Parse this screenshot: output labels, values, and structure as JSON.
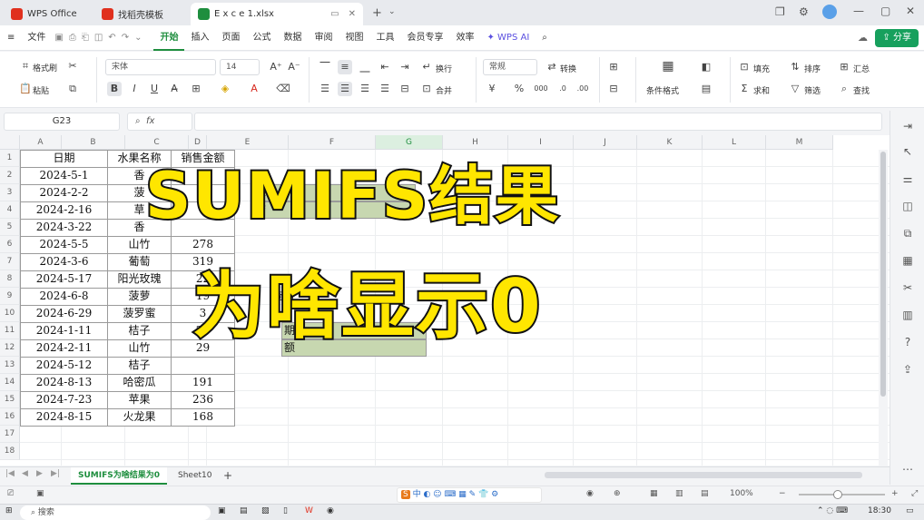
{
  "tabs": [
    {
      "label": "WPS Office",
      "logo_color": "#e0301e"
    },
    {
      "label": "找稻壳模板",
      "logo_color": "#e0301e"
    },
    {
      "label": "E x c e 1.xlsx",
      "logo_color": "#1e8e3e"
    }
  ],
  "menu": {
    "file": "文件",
    "items": [
      "开始",
      "插入",
      "页面",
      "公式",
      "数据",
      "审阅",
      "视图",
      "工具",
      "会员专享",
      "效率"
    ],
    "active": "开始",
    "wps_ai": "WPS AI",
    "share": "分享"
  },
  "ribbon": {
    "format_painter": "格式刷",
    "paste": "粘贴",
    "font_name": "宋体",
    "font_size": "14",
    "wrap": "换行",
    "merge": "合并",
    "number_format": "常规",
    "convert": "转换",
    "cond_format": "条件格式",
    "fill": "填充",
    "sort": "排序",
    "sum": "求和",
    "filter": "筛选",
    "summary": "汇总",
    "find": "查找"
  },
  "formula_bar": {
    "name_box": "G23",
    "fx": "fx",
    "value": ""
  },
  "columns": [
    "A",
    "B",
    "C",
    "D",
    "E",
    "F",
    "G",
    "H",
    "I",
    "J",
    "K",
    "L",
    "M"
  ],
  "selected_column": "G",
  "rows": [
    "1",
    "2",
    "3",
    "4",
    "5",
    "6",
    "7",
    "8",
    "9",
    "10",
    "11",
    "12",
    "13",
    "14",
    "15",
    "16",
    "17",
    "18"
  ],
  "table": {
    "headers": [
      "日期",
      "水果名称",
      "销售金额"
    ],
    "rows": [
      [
        "2024-5-1",
        "香",
        ""
      ],
      [
        "2024-2-2",
        "菠",
        ""
      ],
      [
        "2024-2-16",
        "草",
        ""
      ],
      [
        "2024-3-22",
        "香",
        ""
      ],
      [
        "2024-5-5",
        "山竹",
        "278"
      ],
      [
        "2024-3-6",
        "葡萄",
        "319"
      ],
      [
        "2024-5-17",
        "阳光玫瑰",
        "22"
      ],
      [
        "2024-6-8",
        "菠萝",
        "19"
      ],
      [
        "2024-6-29",
        "菠罗蜜",
        "3"
      ],
      [
        "2024-1-11",
        "桔子",
        "23"
      ],
      [
        "2024-2-11",
        "山竹",
        "29"
      ],
      [
        "2024-5-12",
        "桔子",
        ""
      ],
      [
        "2024-8-13",
        "哈密瓜",
        "191"
      ],
      [
        "2024-7-23",
        "苹果",
        "236"
      ],
      [
        "2024-8-15",
        "火龙果",
        "168"
      ]
    ]
  },
  "partial_cells": {
    "e3": "水",
    "e4": "结",
    "e9": "查询",
    "e11": "期",
    "e12": "额"
  },
  "overlay": {
    "line1": "SUMIFS结果",
    "line2": "为啥显示0"
  },
  "sheets": {
    "active": "SUMIFS为啥结果为0",
    "other": "Sheet10",
    "add": "+"
  },
  "status": {
    "zoom": "100%",
    "ime": "中"
  },
  "taskbar": {
    "search": "搜索",
    "clock": "18:30"
  }
}
